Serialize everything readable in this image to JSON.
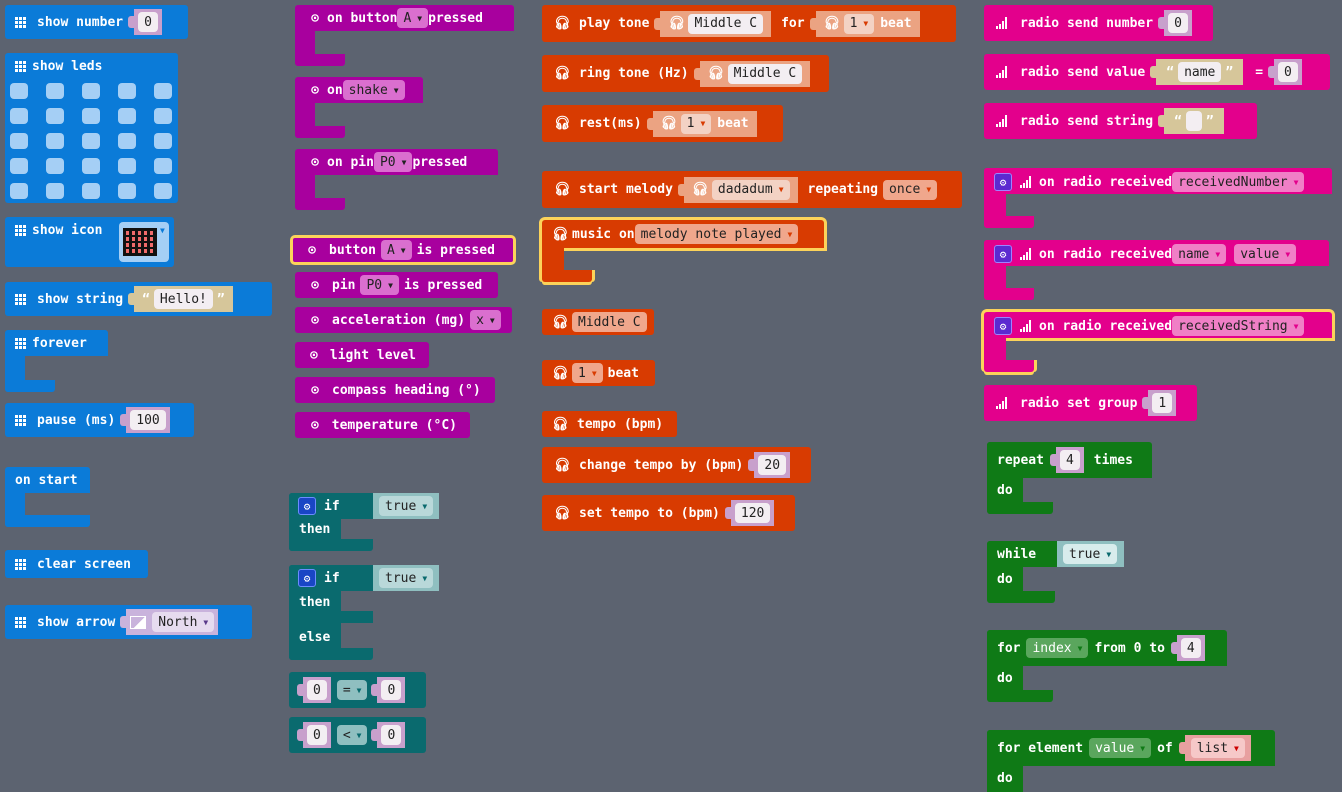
{
  "basic": {
    "color": "#0b7bd8",
    "show_number": {
      "label": "show number",
      "value": "0"
    },
    "show_leds": {
      "label": "show leds",
      "rows": 5,
      "cols": 5
    },
    "show_icon": {
      "label": "show icon",
      "icon": "heart-icon"
    },
    "show_string": {
      "label": "show string",
      "value": "Hello!"
    },
    "forever": {
      "label": "forever"
    },
    "pause": {
      "label": "pause (ms)",
      "value": "100"
    },
    "on_start": {
      "label": "on start"
    },
    "clear_screen": {
      "label": "clear screen"
    },
    "show_arrow": {
      "label": "show arrow",
      "value": "North"
    }
  },
  "input": {
    "color": "#a8009e",
    "on_button": {
      "pre": "on button",
      "value": "A",
      "post": "pressed"
    },
    "on_shake": {
      "pre": "on",
      "value": "shake"
    },
    "on_pin": {
      "pre": "on pin",
      "value": "P0",
      "post": "pressed"
    },
    "button_pressed": {
      "pre": "button",
      "value": "A",
      "post": "is pressed"
    },
    "pin_pressed": {
      "pre": "pin",
      "value": "P0",
      "post": "is pressed"
    },
    "acceleration": {
      "pre": "acceleration (mg)",
      "value": "x"
    },
    "light_level": {
      "label": "light level"
    },
    "compass": {
      "label": "compass heading (°)"
    },
    "temperature": {
      "label": "temperature (°C)"
    }
  },
  "logic": {
    "color": "#0a6a6e",
    "if_then": {
      "if": "if",
      "then": "then",
      "cond": "true"
    },
    "if_then_else": {
      "if": "if",
      "then": "then",
      "else": "else",
      "cond": "true"
    },
    "compare_eq": {
      "left": "0",
      "op": "=",
      "right": "0"
    },
    "compare_lt": {
      "left": "0",
      "op": "<",
      "right": "0"
    }
  },
  "music": {
    "color": "#d83b01",
    "play_tone": {
      "pre": "play tone",
      "note": "Middle C",
      "mid": "for",
      "beat": "1",
      "beat_label": "beat"
    },
    "ring_tone": {
      "pre": "ring tone (Hz)",
      "note": "Middle C"
    },
    "rest": {
      "pre": "rest(ms)",
      "beat": "1",
      "beat_label": "beat"
    },
    "start_melody": {
      "pre": "start melody",
      "melody": "dadadum",
      "mid": "repeating",
      "repeat": "once"
    },
    "music_on": {
      "pre": "music on",
      "event": "melody note played"
    },
    "note": {
      "value": "Middle C"
    },
    "beat": {
      "value": "1",
      "label": "beat"
    },
    "tempo": {
      "label": "tempo (bpm)"
    },
    "change_tempo": {
      "pre": "change tempo by (bpm)",
      "value": "20"
    },
    "set_tempo": {
      "pre": "set tempo to (bpm)",
      "value": "120"
    }
  },
  "radio": {
    "color": "#e3008c",
    "send_number": {
      "pre": "radio send number",
      "value": "0"
    },
    "send_value": {
      "pre": "radio send value",
      "name": "name",
      "eq": "=",
      "value": "0"
    },
    "send_string": {
      "pre": "radio send string",
      "value": ""
    },
    "recv_number": {
      "pre": "on radio received",
      "var": "receivedNumber"
    },
    "recv_value": {
      "pre": "on radio received",
      "var1": "name",
      "var2": "value"
    },
    "recv_string": {
      "pre": "on radio received",
      "var": "receivedString"
    },
    "set_group": {
      "pre": "radio set group",
      "value": "1"
    }
  },
  "loops": {
    "color": "#0f7a16",
    "repeat": {
      "pre": "repeat",
      "value": "4",
      "post": "times",
      "do": "do"
    },
    "while": {
      "pre": "while",
      "cond": "true",
      "do": "do"
    },
    "for_index": {
      "pre": "for",
      "var": "index",
      "mid": "from 0 to",
      "value": "4",
      "do": "do"
    },
    "for_element": {
      "pre": "for element",
      "var": "value",
      "mid": "of",
      "list": "list",
      "do": "do"
    }
  }
}
